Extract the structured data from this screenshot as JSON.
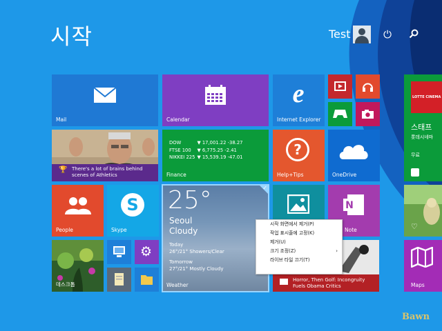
{
  "screen": {
    "title": "시작",
    "user_name": "Test",
    "watermark": "Bawn"
  },
  "icons": {
    "power": "power-icon",
    "search": "search-icon",
    "mail": "mail-icon",
    "calendar": "calendar-icon",
    "ie": "internet-explorer-icon",
    "video": "video-icon",
    "music": "headphones-icon",
    "games": "xbox-controller-icon",
    "camera": "camera-icon",
    "help": "question-icon",
    "onedrive": "cloud-icon",
    "people": "people-icon",
    "skype": "skype-icon",
    "photos": "photos-icon",
    "onenote": "onenote-icon",
    "trophy": "trophy-icon"
  },
  "tiles": {
    "mail": "Mail",
    "calendar": "Calendar",
    "ie": "Internet Explorer",
    "athletics": {
      "line1": "There's a lot of brains behind",
      "line2": "scenes of Athletics"
    },
    "finance": {
      "label": "Finance",
      "rows": [
        {
          "name": "DOW",
          "value": "▼ 17,001.22 -38.27"
        },
        {
          "name": "FTSE 100",
          "value": "▼ 6,775.25 -2.41"
        },
        {
          "name": "NIKKEI 225",
          "value": "▼ 15,539.19 -47.01"
        }
      ]
    },
    "help": "Help+Tips",
    "onedrive": "OneDrive",
    "people": "People",
    "skype": "Skype",
    "desktop": "데스크톱",
    "weather": {
      "temp": "25°",
      "city": "Seoul",
      "cond": "Cloudy",
      "today_label": "Today",
      "today": "26°/21° Showers/Clear",
      "tomorrow_label": "Tomorrow",
      "tomorrow": "27°/21° Mostly Cloudy",
      "label": "Weather"
    },
    "onenote": "Note",
    "news": {
      "line1": "Horror, Then Golf: Incongruity",
      "line2": "Fuels Obama Critics"
    },
    "store": {
      "banner": "LOTTE CINEMA",
      "title": "스태프",
      "subtitle": "롯데시네마",
      "price": "무료"
    },
    "maps": "Maps"
  },
  "context_menu": [
    {
      "label": "시작 화면에서 제거(P)"
    },
    {
      "label": "작업 표시줄에 고정(K)"
    },
    {
      "label": "제거(U)"
    },
    {
      "label": "크기 조정(Z)",
      "arrow": "›"
    },
    {
      "label": "라이브 타일 끄기(T)"
    }
  ],
  "colors": {
    "bg": "#1e98e8",
    "mail": "#1f79d4",
    "calendar": "#7f3ec2",
    "ie": "#1e7fd8",
    "red": "#e24a2d",
    "green": "#0b9b3a",
    "finance": "#0b9b3a",
    "help": "#e4572e",
    "onedrive": "#0f6bd0",
    "people": "#e24a2d",
    "skype": "#14a7e6",
    "onenote": "#a33cae",
    "maps": "#a32cb6"
  }
}
